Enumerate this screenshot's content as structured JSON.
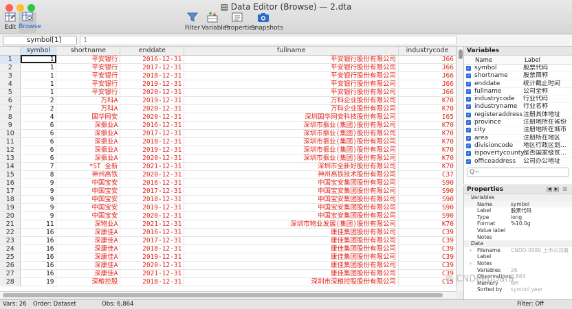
{
  "window": {
    "title": "Data Editor (Browse) — 2.dta"
  },
  "toolbar": [
    {
      "label": "Edit",
      "icon": "edit-grid-icon"
    },
    {
      "label": "Browse",
      "icon": "browse-grid-icon"
    },
    {
      "label": "Filter",
      "icon": "filter-icon"
    },
    {
      "label": "Variables",
      "icon": "variables-icon"
    },
    {
      "label": "Properties",
      "icon": "properties-icon"
    },
    {
      "label": "Snapshots",
      "icon": "camera-icon"
    }
  ],
  "editbar": {
    "varname": "symbol[1]",
    "value": "1"
  },
  "grid": {
    "columns": [
      "symbol",
      "shortname",
      "enddate",
      "fullname",
      "industrycode"
    ],
    "rows": [
      [
        "1",
        "1",
        "平安银行",
        "2016-12-31",
        "平安银行股份有限公司",
        "J66"
      ],
      [
        "2",
        "1",
        "平安银行",
        "2017-12-31",
        "平安银行股份有限公司",
        "J66"
      ],
      [
        "3",
        "1",
        "平安银行",
        "2018-12-31",
        "平安银行股份有限公司",
        "J66"
      ],
      [
        "4",
        "1",
        "平安银行",
        "2019-12-31",
        "平安银行股份有限公司",
        "J66"
      ],
      [
        "5",
        "1",
        "平安银行",
        "2020-12-31",
        "平安银行股份有限公司",
        "J66"
      ],
      [
        "6",
        "2",
        "万科A",
        "2019-12-31",
        "万科企业股份有限公司",
        "K70"
      ],
      [
        "7",
        "2",
        "万科A",
        "2020-12-31",
        "万科企业股份有限公司",
        "K70"
      ],
      [
        "8",
        "4",
        "国华网安",
        "2020-12-31",
        "深圳国华网安科技股份有限公司",
        "I65"
      ],
      [
        "9",
        "6",
        "深振业A",
        "2016-12-31",
        "深圳市振业(集团)股份有限公司",
        "K70"
      ],
      [
        "10",
        "6",
        "深振业A",
        "2017-12-31",
        "深圳市振业(集团)股份有限公司",
        "K70"
      ],
      [
        "11",
        "6",
        "深振业A",
        "2018-12-31",
        "深圳市振业(集团)股份有限公司",
        "K70"
      ],
      [
        "12",
        "6",
        "深振业A",
        "2019-12-31",
        "深圳市振业(集团)股份有限公司",
        "K70"
      ],
      [
        "13",
        "6",
        "深振业A",
        "2020-12-31",
        "深圳市振业(集团)股份有限公司",
        "K70"
      ],
      [
        "14",
        "7",
        "*ST 全新",
        "2021-12-31",
        "深圳市全新好股份有限公司",
        "K70"
      ],
      [
        "15",
        "8",
        "神州高铁",
        "2020-12-31",
        "神州高铁技术股份有限公司",
        "C37"
      ],
      [
        "16",
        "9",
        "中国宝安",
        "2016-12-31",
        "中国宝安集团股份有限公司",
        "S90"
      ],
      [
        "17",
        "9",
        "中国宝安",
        "2017-12-31",
        "中国宝安集团股份有限公司",
        "S90"
      ],
      [
        "18",
        "9",
        "中国宝安",
        "2018-12-31",
        "中国宝安集团股份有限公司",
        "S90"
      ],
      [
        "19",
        "9",
        "中国宝安",
        "2019-12-31",
        "中国宝安集团股份有限公司",
        "S90"
      ],
      [
        "20",
        "9",
        "中国宝安",
        "2020-12-31",
        "中国宝安集团股份有限公司",
        "S90"
      ],
      [
        "21",
        "11",
        "深物业A",
        "2021-12-31",
        "深圳市物业发展(集团)股份有限公司",
        "K70"
      ],
      [
        "22",
        "16",
        "深康佳A",
        "2016-12-31",
        "康佳集团股份有限公司",
        "C39"
      ],
      [
        "23",
        "16",
        "深康佳A",
        "2017-12-31",
        "康佳集团股份有限公司",
        "C39"
      ],
      [
        "24",
        "16",
        "深康佳A",
        "2018-12-31",
        "康佳集团股份有限公司",
        "C39"
      ],
      [
        "25",
        "16",
        "深康佳A",
        "2019-12-31",
        "康佳集团股份有限公司",
        "C39"
      ],
      [
        "26",
        "16",
        "深康佳A",
        "2020-12-31",
        "康佳集团股份有限公司",
        "C39"
      ],
      [
        "27",
        "16",
        "深康佳A",
        "2021-12-31",
        "康佳集团股份有限公司",
        "C39"
      ],
      [
        "28",
        "19",
        "深粮控股",
        "2018-12-31",
        "深圳市深粮控股股份有限公司",
        "C15"
      ]
    ]
  },
  "variables_panel": {
    "title": "Variables",
    "col_name": "Name",
    "col_label": "Label",
    "items": [
      {
        "name": "symbol",
        "label": "股票代码"
      },
      {
        "name": "shortname",
        "label": "股票简称"
      },
      {
        "name": "enddate",
        "label": "统计截止时间"
      },
      {
        "name": "fullname",
        "label": "公司全称"
      },
      {
        "name": "industrycode",
        "label": "行业代码"
      },
      {
        "name": "industryname",
        "label": "行业名称"
      },
      {
        "name": "registeraddress",
        "label": "注册具体地址"
      },
      {
        "name": "province",
        "label": "注册地所在省份"
      },
      {
        "name": "city",
        "label": "注册地所在城市"
      },
      {
        "name": "area",
        "label": "注册所在地区"
      },
      {
        "name": "divisioncode",
        "label": "地区行政区划..."
      },
      {
        "name": "ispovertycounty",
        "label": "是否国家级贫..."
      },
      {
        "name": "officeaddress",
        "label": "公司办公地址"
      }
    ],
    "search_placeholder": "Q~"
  },
  "properties_panel": {
    "title": "Properties",
    "section_variables": "Variables",
    "variable_props": [
      {
        "key": "Name",
        "value": "symbol"
      },
      {
        "key": "Label",
        "value": "股票代码"
      },
      {
        "key": "Type",
        "value": "long"
      },
      {
        "key": "Format",
        "value": "%10.0g"
      },
      {
        "key": "Value label",
        "value": ""
      },
      {
        "key": "Notes",
        "value": ""
      }
    ],
    "section_data": "Data",
    "data_props": [
      {
        "key": "Filename",
        "value": "CNDD-0080 上市公司概",
        "arrow": "›"
      },
      {
        "key": "Label",
        "value": "",
        "arrow": ""
      },
      {
        "key": "Notes",
        "value": "",
        "arrow": "›"
      },
      {
        "key": "Variables",
        "value": "26",
        "arrow": ""
      },
      {
        "key": "Observations",
        "value": "6,864",
        "arrow": ""
      },
      {
        "key": "Memory",
        "value": "6M",
        "arrow": ""
      },
      {
        "key": "Sorted by",
        "value": "symbol year",
        "arrow": ""
      }
    ]
  },
  "status": {
    "vars": "Vars: 26",
    "order": "Order: Dataset",
    "obs": "Obs: 6,864",
    "filter": "Filter: Off"
  },
  "watermark": "CNDeepData",
  "colors": {
    "string_text": "#e0261b",
    "accent": "#1763d6"
  }
}
